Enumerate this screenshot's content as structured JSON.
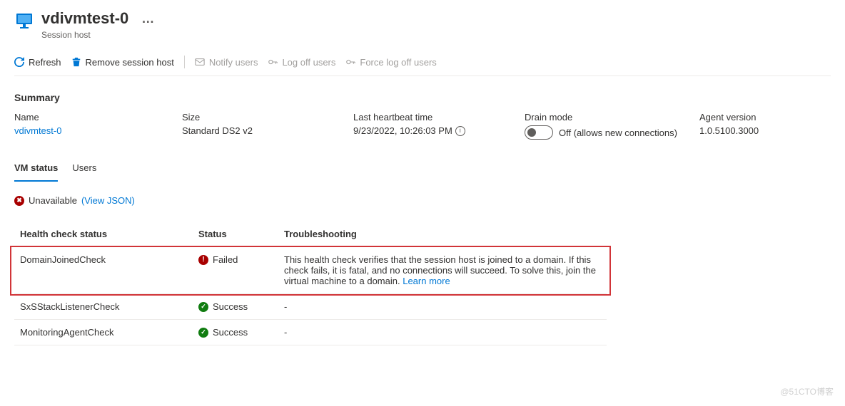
{
  "header": {
    "title": "vdivmtest-0",
    "subtitle": "Session host"
  },
  "toolbar": {
    "refresh": "Refresh",
    "remove": "Remove session host",
    "notify": "Notify users",
    "logoff": "Log off users",
    "force_logoff": "Force log off users"
  },
  "summary": {
    "heading": "Summary",
    "name_label": "Name",
    "name_value": "vdivmtest-0",
    "size_label": "Size",
    "size_value": "Standard DS2 v2",
    "heartbeat_label": "Last heartbeat time",
    "heartbeat_value": "9/23/2022, 10:26:03 PM",
    "drain_label": "Drain mode",
    "drain_value": "Off (allows new connections)",
    "agent_label": "Agent version",
    "agent_value": "1.0.5100.3000"
  },
  "tabs": {
    "vm_status": "VM status",
    "users": "Users"
  },
  "status_line": {
    "state": "Unavailable",
    "view_json": "(View JSON)"
  },
  "table": {
    "headers": {
      "check": "Health check status",
      "status": "Status",
      "trouble": "Troubleshooting"
    },
    "rows": [
      {
        "check": "DomainJoinedCheck",
        "status": "Failed",
        "status_kind": "fail",
        "trouble": "This health check verifies that the session host is joined to a domain. If this check fails, it is fatal, and no connections will succeed. To solve this, join the virtual machine to a domain.",
        "learn_more": "Learn more"
      },
      {
        "check": "SxSStackListenerCheck",
        "status": "Success",
        "status_kind": "success",
        "trouble": "-",
        "learn_more": ""
      },
      {
        "check": "MonitoringAgentCheck",
        "status": "Success",
        "status_kind": "success",
        "trouble": "-",
        "learn_more": ""
      }
    ]
  },
  "watermark": "@51CTO博客"
}
